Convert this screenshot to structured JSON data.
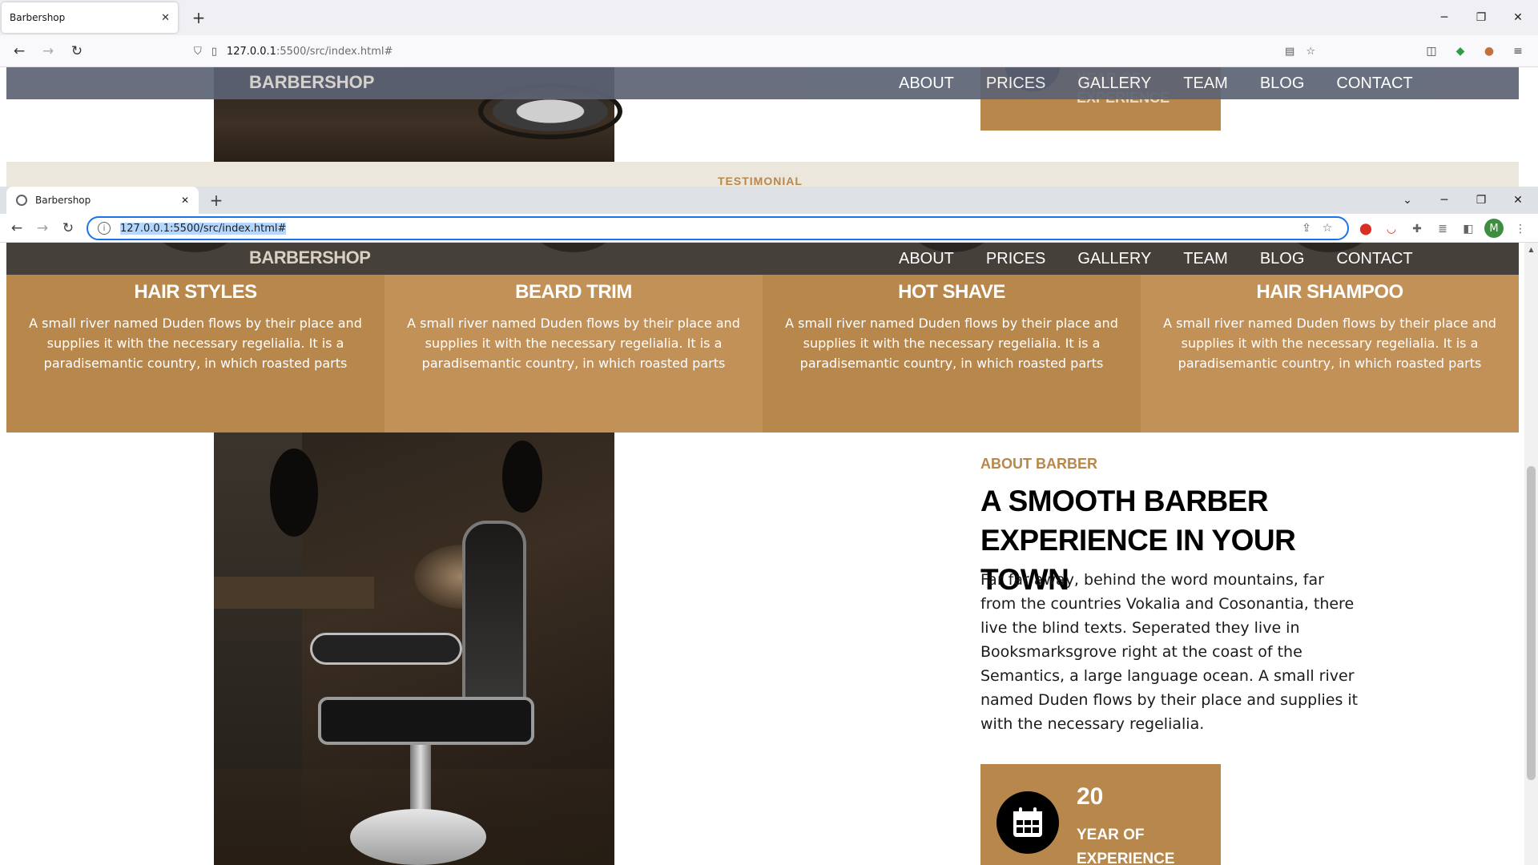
{
  "background_browser": {
    "tab_title": "Barbershop",
    "url_host": "127.0.0.1",
    "url_rest": ":5500/src/index.html#",
    "page": {
      "logo": "BARBERSHOP",
      "menu": [
        "ABOUT",
        "PRICES",
        "GALLERY",
        "TEAM",
        "BLOG",
        "CONTACT"
      ],
      "year_label": "YEAR OF EXPERIENCE",
      "section_label": "TESTIMONIAL"
    }
  },
  "browser": {
    "tab_title": "Barbershop",
    "url": "127.0.0.1:5500/src/index.html#",
    "profile_initial": "M"
  },
  "site": {
    "logo": "BARBERSHOP",
    "menu": [
      "ABOUT",
      "PRICES",
      "GALLERY",
      "TEAM",
      "BLOG",
      "CONTACT"
    ],
    "services": [
      {
        "title": "HAIR STYLES",
        "text": "A small river named Duden flows by their place and supplies it with the necessary regelialia. It is a paradisemantic country, in which roasted parts",
        "color": "#b8874b"
      },
      {
        "title": "BEARD TRIM",
        "text": "A small river named Duden flows by their place and supplies it with the necessary regelialia. It is a paradisemantic country, in which roasted parts",
        "color": "#c29157"
      },
      {
        "title": "HOT SHAVE",
        "text": "A small river named Duden flows by their place and supplies it with the necessary regelialia. It is a paradisemantic country, in which roasted parts",
        "color": "#b8874b"
      },
      {
        "title": "HAIR SHAMPOO",
        "text": "A small river named Duden flows by their place and supplies it with the necessary regelialia. It is a paradisemantic country, in which roasted parts",
        "color": "#c29157"
      }
    ],
    "about": {
      "kicker": "ABOUT BARBER",
      "heading": "A SMOOTH BARBER EXPERIENCE IN YOUR TOWN",
      "text": "Far far away, behind the word mountains, far from the countries Vokalia and Cosonantia, there live the blind texts. Seperated they live in Booksmarksgrove right at the coast of the Semantics, a large language ocean. A small river named Duden flows by their place and supplies it with the necessary regelialia.",
      "years": "20",
      "years_label": "YEAR OF EXPERIENCE"
    }
  },
  "colors": {
    "accent": "#b8874b",
    "nav_bg": "#46403b"
  }
}
